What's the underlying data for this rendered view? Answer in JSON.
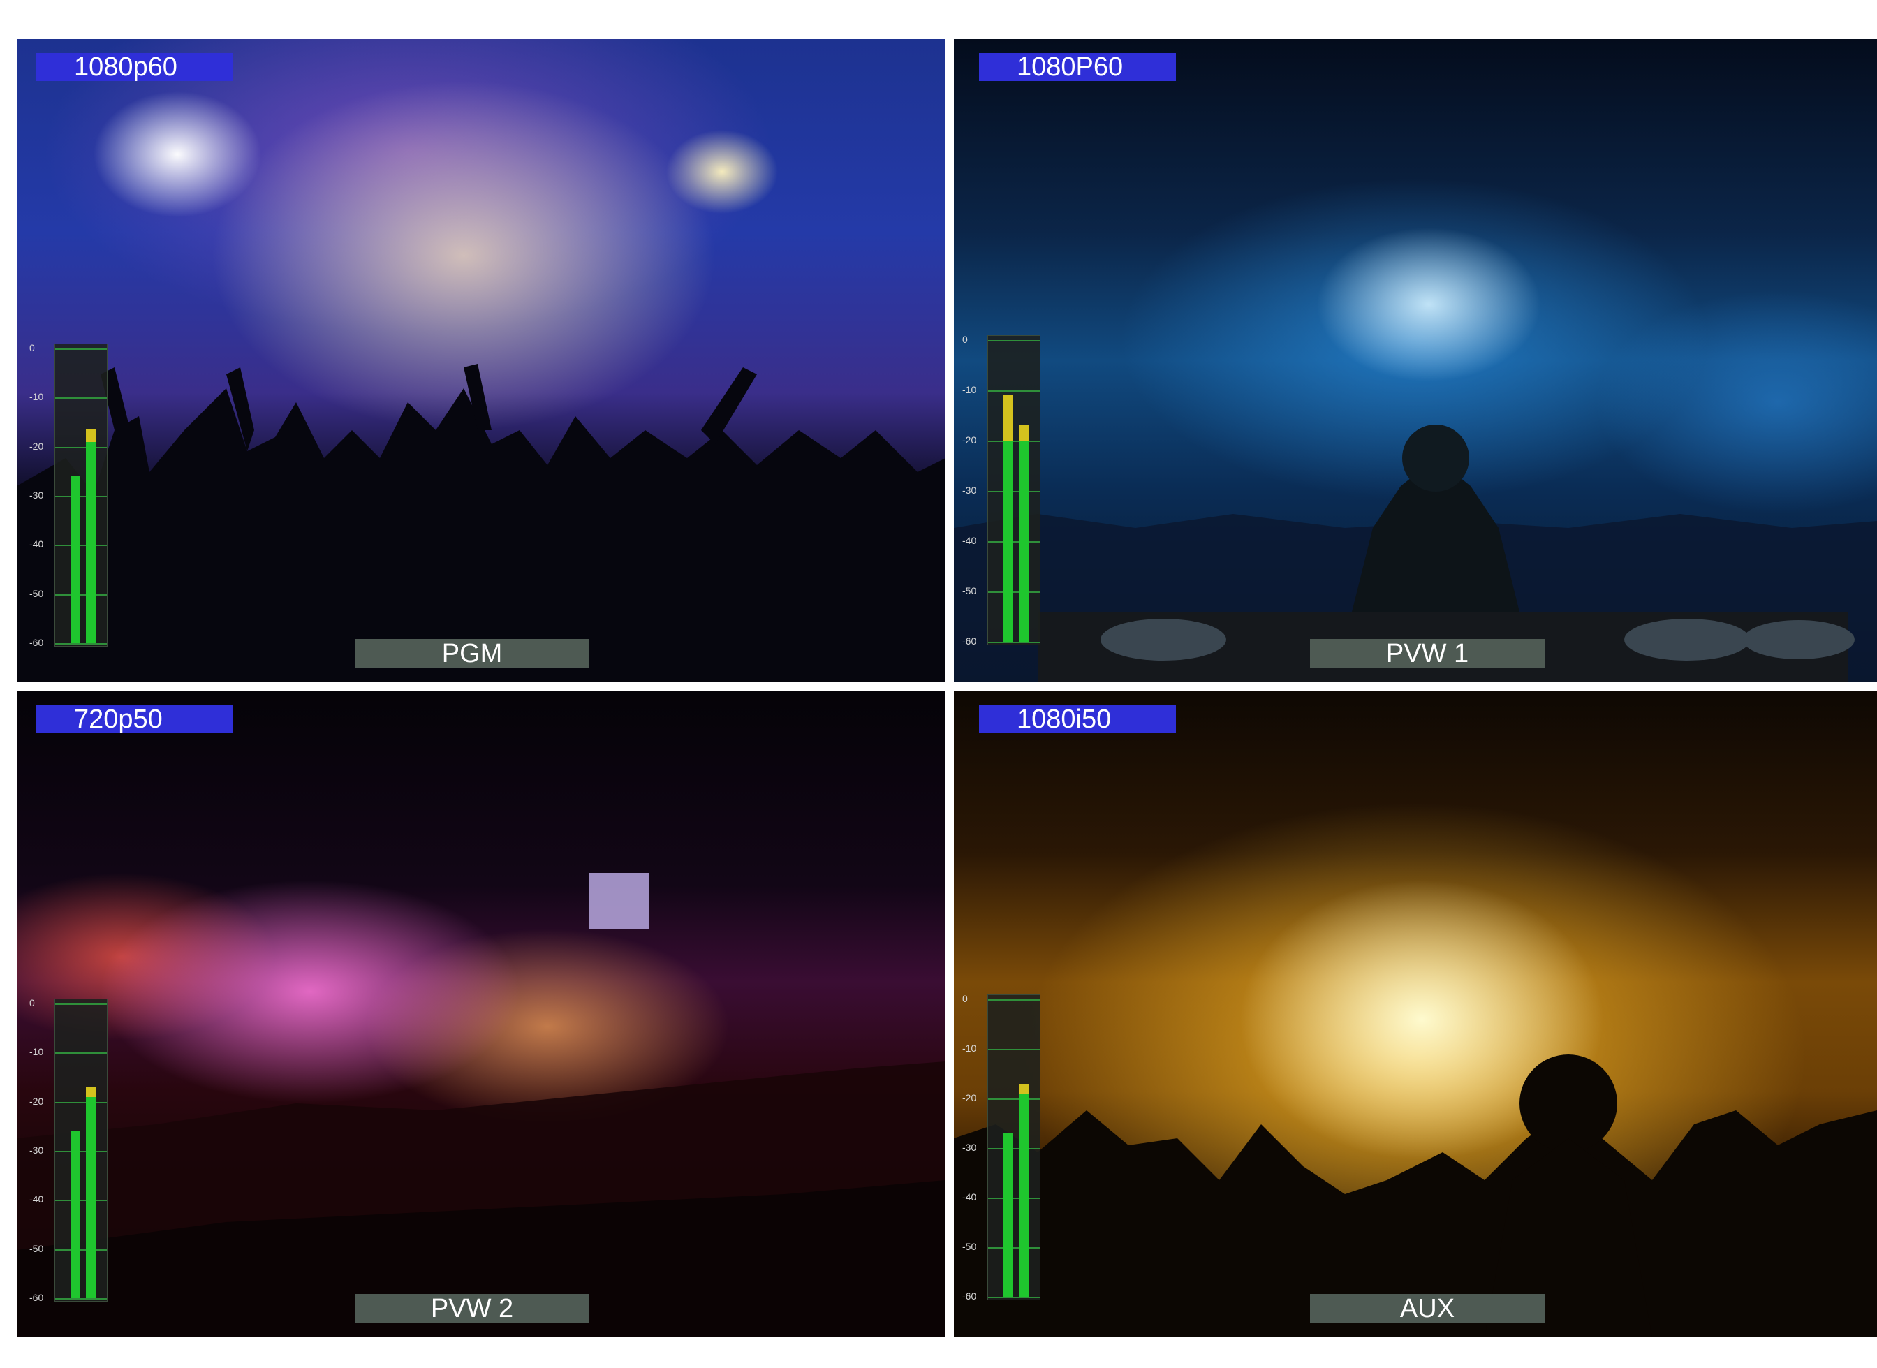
{
  "monitor": {
    "tiles": [
      {
        "format": "1080p60",
        "source": "PGM",
        "meter": {
          "ticks": [
            "0",
            "-10",
            "-20",
            "-30",
            "-40",
            "-50",
            "-60"
          ],
          "channels": [
            {
              "level_db": -26,
              "peak_db": -26
            },
            {
              "level_db": -19,
              "peak_db": -16.5
            }
          ]
        }
      },
      {
        "format": "1080P60",
        "source": "PVW 1",
        "meter": {
          "ticks": [
            "0",
            "-10",
            "-20",
            "-30",
            "-40",
            "-50",
            "-60"
          ],
          "channels": [
            {
              "level_db": -20,
              "peak_db": -11
            },
            {
              "level_db": -20,
              "peak_db": -17
            }
          ]
        }
      },
      {
        "format": "720p50",
        "source": "PVW 2",
        "meter": {
          "ticks": [
            "0",
            "-10",
            "-20",
            "-30",
            "-40",
            "-50",
            "-60"
          ],
          "channels": [
            {
              "level_db": -26,
              "peak_db": -26
            },
            {
              "level_db": -19,
              "peak_db": -17
            }
          ]
        }
      },
      {
        "format": "1080i50",
        "source": "AUX",
        "meter": {
          "ticks": [
            "0",
            "-10",
            "-20",
            "-30",
            "-40",
            "-50",
            "-60"
          ],
          "channels": [
            {
              "level_db": -27,
              "peak_db": -27
            },
            {
              "level_db": -19,
              "peak_db": -17
            }
          ]
        }
      }
    ],
    "colors": {
      "badge_bg": "#2f2fd8",
      "label_bg": "#4e5a53",
      "meter_green": "#1fc62e",
      "meter_yellow": "#d4c21e"
    }
  }
}
